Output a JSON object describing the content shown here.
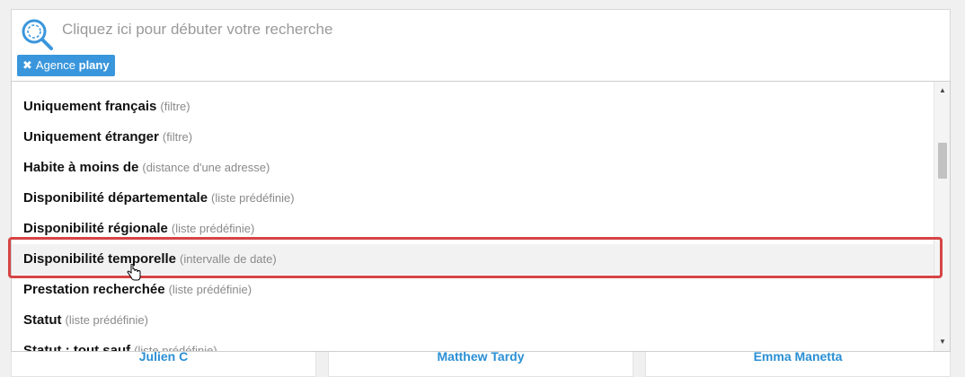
{
  "search": {
    "placeholder": "Cliquez ici pour débuter votre recherche",
    "tag": {
      "prefix": "Agence",
      "value": "plany",
      "remove_icon": "times-icon"
    }
  },
  "dropdown": {
    "items": [
      {
        "name": "Uniquement français",
        "hint": "(filtre)"
      },
      {
        "name": "Uniquement étranger",
        "hint": "(filtre)"
      },
      {
        "name": "Habite à moins de",
        "hint": "(distance d'une adresse)"
      },
      {
        "name": "Disponibilité départementale",
        "hint": "(liste prédéfinie)"
      },
      {
        "name": "Disponibilité régionale",
        "hint": "(liste prédéfinie)"
      },
      {
        "name": "Disponibilité temporelle",
        "hint": "(intervalle de date)"
      },
      {
        "name": "Prestation recherchée",
        "hint": "(liste prédéfinie)"
      },
      {
        "name": "Statut",
        "hint": "(liste prédéfinie)"
      },
      {
        "name": "Statut : tout sauf",
        "hint": "(liste prédéfinie)"
      }
    ],
    "highlighted_index": 5
  },
  "cards": [
    {
      "name": "Julien C"
    },
    {
      "name": "Matthew Tardy"
    },
    {
      "name": "Emma Manetta"
    }
  ],
  "colors": {
    "accent": "#3a96dc",
    "highlight_border": "#d64545",
    "card_name": "#2a8fd4"
  }
}
